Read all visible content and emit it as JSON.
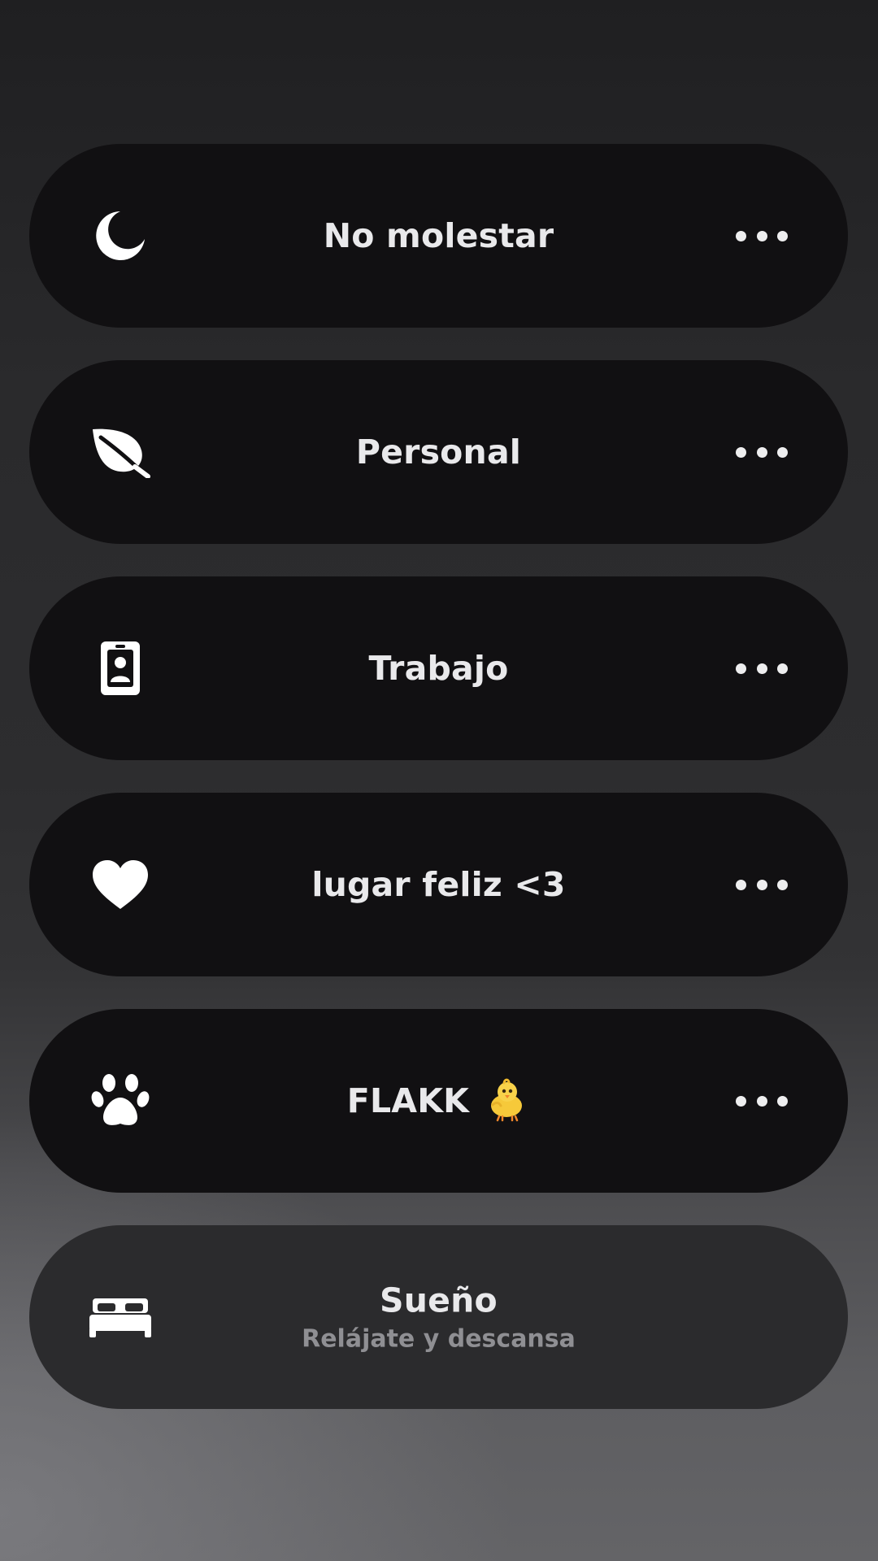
{
  "focus_modes": [
    {
      "id": "no-molestar",
      "label": "No molestar",
      "icon": "moon-icon",
      "has_options": true
    },
    {
      "id": "personal",
      "label": "Personal",
      "icon": "leaf-icon",
      "has_options": true
    },
    {
      "id": "trabajo",
      "label": "Trabajo",
      "icon": "id-badge-icon",
      "has_options": true
    },
    {
      "id": "lugar-feliz",
      "label": "lugar feliz <3",
      "icon": "heart-icon",
      "has_options": true
    },
    {
      "id": "flakk",
      "label": "FLAKK",
      "emoji": "chick-emoji",
      "icon": "paw-icon",
      "has_options": true
    },
    {
      "id": "sueno",
      "label": "Sueño",
      "sublabel": "Relájate y descansa",
      "icon": "bed-icon",
      "has_options": false
    }
  ],
  "colors": {
    "pill_active": "#111012",
    "pill_inactive": "#2b2b2d",
    "text_primary": "#e9e9eb",
    "text_secondary": "#8f8f93",
    "icon": "#ffffff"
  }
}
